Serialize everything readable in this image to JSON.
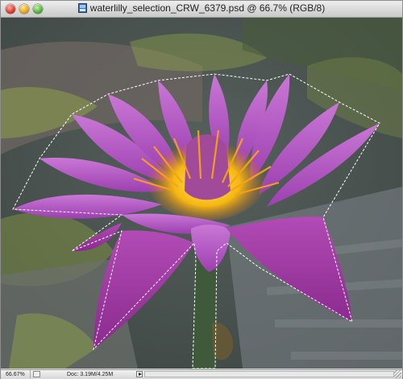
{
  "window": {
    "title": "waterlilly_selection_CRW_6379.psd @ 66.7% (RGB/8)",
    "file_icon": "psd-document-icon"
  },
  "status": {
    "zoom": "66.67%",
    "doc_info": "Doc: 3.19M/4.25M"
  },
  "colors": {
    "petal": "#b957c8",
    "petal_dark": "#8e3aa0",
    "center_yellow": "#f6c515",
    "stem": "#3f5a3a",
    "background": "#5f6a63"
  },
  "icons": {
    "close": "close-icon",
    "minimize": "minimize-icon",
    "zoom": "zoom-icon",
    "status_menu": "triangle-right-icon"
  }
}
